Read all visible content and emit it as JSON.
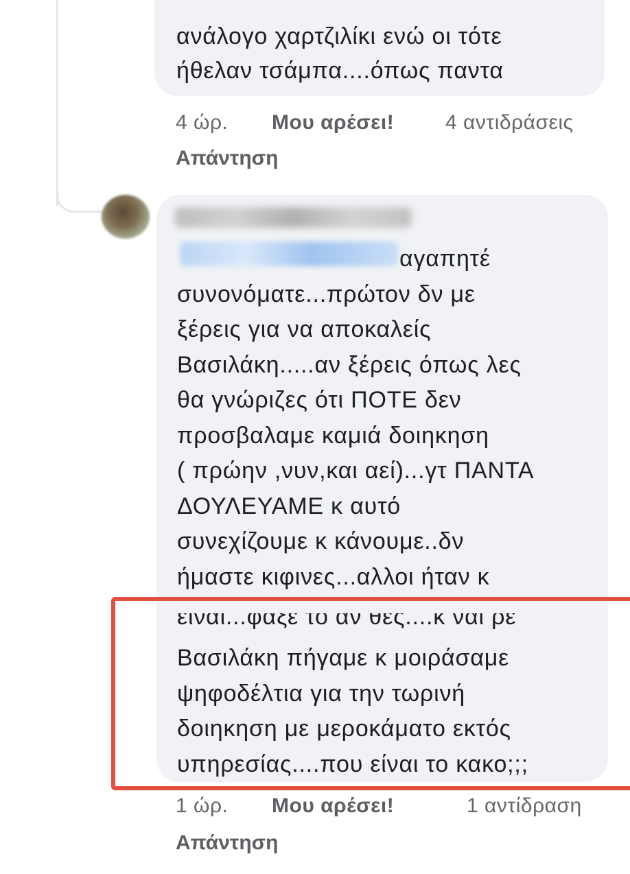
{
  "comment_1": {
    "text_lines": "ανάλογο χαρτζιλίκι ενώ οι τότε\nήθελαν τσάμπα....όπως παντα",
    "time": "4 ώρ.",
    "like_label": "Μου αρέσει!",
    "reactions": "4 αντιδράσεις",
    "reply_label": "Απάντηση"
  },
  "comment_2": {
    "first_line_rest": "αγαπητέ",
    "body_lines": "συνονόματε...πρώτον δν με\nξέρεις για να αποκαλείς\nΒασιλάκη.....αν ξέρεις όπως λες\nθα γνώριζες ότι ΠΟΤΕ δεν\nπροσβαλαμε καμιά δοιηκηση\n( πρώην ,νυν,και αεί)...γτ ΠΑΝΤΑ\nΔΟΥΛΕΥΑΜΕ κ αυτό\nσυνεχίζουμε κ κάνουμε..δν\nήμαστε κιφινες...αλλοι ήταν κ",
    "highlighted_first_line": "είναι...φάξε το αν θες....κ ναι ρε",
    "highlighted_lines": "Βασιλάκη πήγαμε κ μοιράσαμε\nψηφοδέλτια για την τωρινή\nδοιηκηση με μεροκάματο εκτός\nυπηρεσίας....που είναι το κακο;;;",
    "time": "1 ώρ.",
    "like_label": "Μου αρέσει!",
    "reactions": "1 αντίδραση",
    "reply_label": "Απάντηση"
  },
  "colors": {
    "bubble": "#f0f2f5",
    "meta_text": "#65676b",
    "highlight": "#e2503f",
    "mention_blur": "#b8d4f5"
  }
}
